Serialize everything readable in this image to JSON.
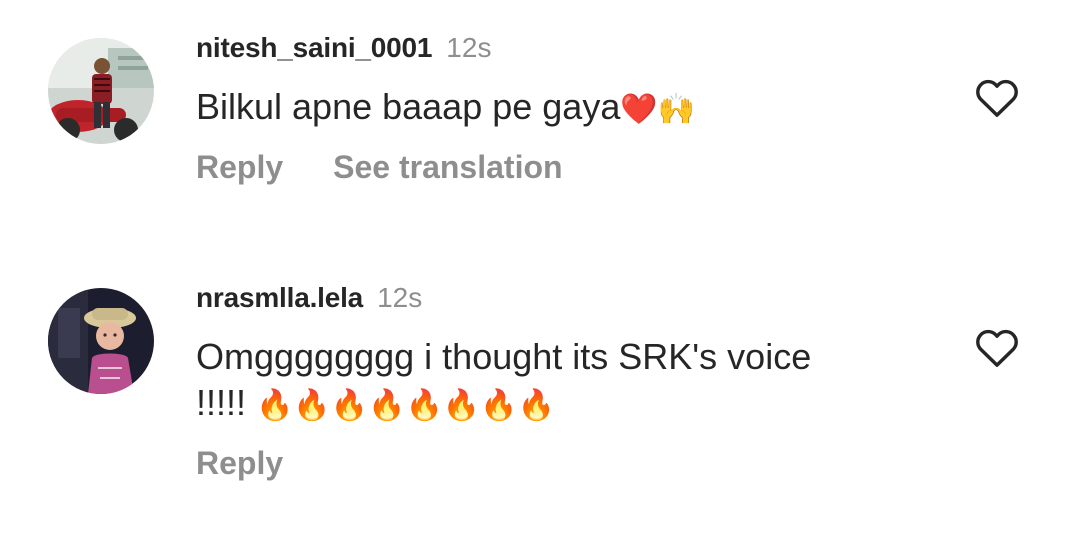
{
  "comments": [
    {
      "username": "nitesh_saini_0001",
      "time": "12s",
      "text": "Bilkul apne baaap pe gaya",
      "emojis": "❤️🙌",
      "actions": [
        "Reply",
        "See translation"
      ]
    },
    {
      "username": "nrasmlla.lela",
      "time": "12s",
      "text": "Omgggggggg i thought its SRK's voice !!!!!",
      "emojis": "🔥🔥🔥🔥🔥🔥🔥🔥",
      "actions": [
        "Reply"
      ]
    }
  ],
  "icons": {
    "like": "heart-outline-icon",
    "avatar_placeholder": "profile-photo"
  },
  "colors": {
    "text": "#262626",
    "secondary": "#8e8e8e",
    "background": "#ffffff"
  }
}
